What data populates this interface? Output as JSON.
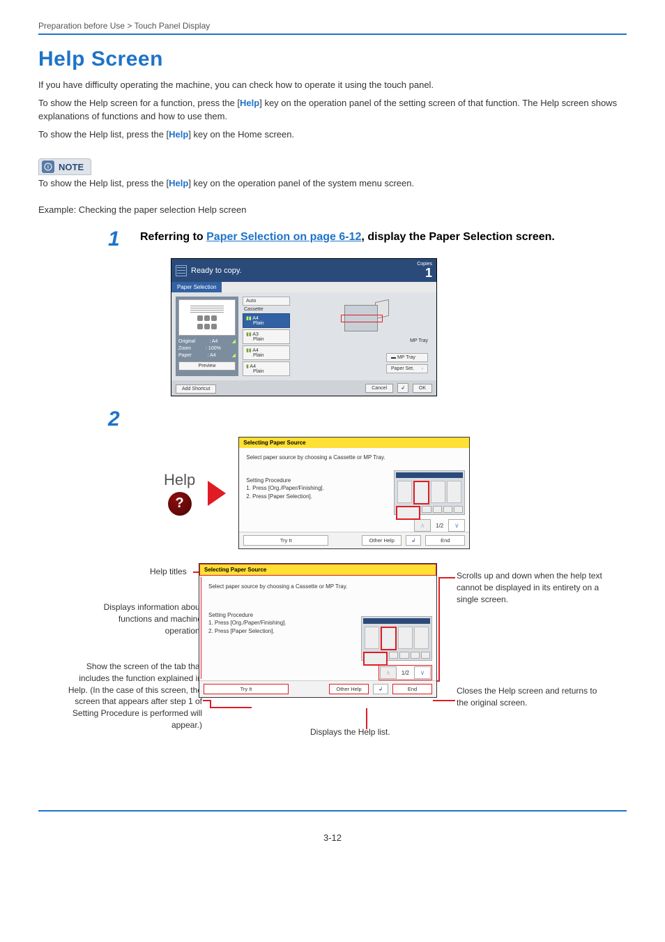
{
  "breadcrumb": "Preparation before Use > Touch Panel Display",
  "title": "Help Screen",
  "intro1": "If you have difficulty operating the machine, you can check how to operate it using the touch panel.",
  "intro2_a": "To show the Help screen for a function, press the [",
  "intro2_key": "Help",
  "intro2_b": "] key on the operation panel of the setting screen of that function. The Help screen shows explanations of functions and how to use them.",
  "intro3_a": "To show the Help list, press the [",
  "intro3_key": "Help",
  "intro3_b": "] key on the Home screen.",
  "note_label": "NOTE",
  "note_text_a": "To show the Help list, press the [",
  "note_text_key": "Help",
  "note_text_b": "] key on the operation panel of the system menu screen.",
  "example_line": "Example: Checking the paper selection Help screen",
  "step1": {
    "num": "1",
    "text_a": "Referring to ",
    "link": "Paper Selection on page 6-12",
    "text_b": ", display the Paper Selection screen."
  },
  "step2_num": "2",
  "shot1": {
    "ready": "Ready to copy.",
    "copies_label": "Copies",
    "copies_value": "1",
    "tab": "Paper Selection",
    "left": {
      "original_label": "Original",
      "original_val": ": A4",
      "zoom_label": "Zoom",
      "zoom_val": ": 100%",
      "paper_label": "Paper",
      "paper_val": ": A4",
      "preview": "Preview"
    },
    "mid": {
      "auto": "Auto",
      "cassette": "Cassette",
      "row1_top": "A4",
      "row1_bot": "Plain",
      "row2_top": "A3",
      "row2_bot": "Plain",
      "row3_top": "A4",
      "row3_bot": "Plain",
      "row4_top": "A4",
      "row4_bot": "Plain"
    },
    "right": {
      "mp_label": "MP Tray",
      "mp_btn": "MP Tray",
      "paperset_btn": "Paper Set."
    },
    "foot": {
      "add_shortcut": "Add Shortcut",
      "cancel": "Cancel",
      "ok": "OK"
    }
  },
  "help_button_label": "Help",
  "help_shot": {
    "bar": "Selecting Paper Source",
    "desc": "Select paper source by choosing a Cassette or MP Tray.",
    "proc_title": "Setting Procedure",
    "proc1": "1. Press [Org./Paper/Finishing].",
    "proc2": "2. Press [Paper Selection].",
    "page_lbl": "1/2",
    "try_it": "Try It",
    "other_help": "Other Help",
    "end": "End"
  },
  "annotations": {
    "help_titles": "Help titles",
    "displays_info": "Displays information about functions and machine operation.",
    "show_screen": "Show the screen of the tab that includes the function explained in Help. (In the case of this screen, the screen that appears after step 1 of Setting Procedure is performed will appear.)",
    "scrolls": "Scrolls up and down when the help text cannot be displayed in its entirety on a single screen.",
    "closes": "Closes the Help screen and returns to the original screen.",
    "displays_list": "Displays the Help list."
  },
  "page_number": "3-12"
}
